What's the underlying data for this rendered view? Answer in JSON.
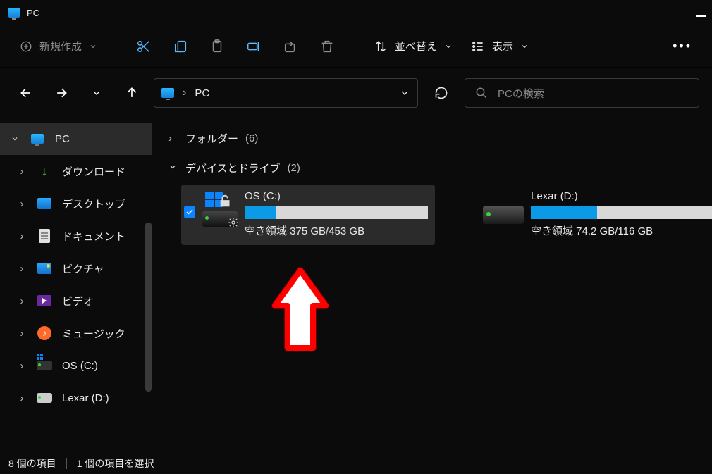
{
  "window": {
    "title": "PC"
  },
  "toolbar": {
    "new_label": "新規作成",
    "sort_label": "並べ替え",
    "view_label": "表示"
  },
  "breadcrumb": {
    "root": "PC"
  },
  "search": {
    "placeholder": "PCの検索"
  },
  "sidebar": {
    "items": [
      {
        "label": "PC",
        "icon": "monitor",
        "expanded": true,
        "selected": true
      },
      {
        "label": "ダウンロード",
        "icon": "download",
        "child": true
      },
      {
        "label": "デスクトップ",
        "icon": "desktop",
        "child": true
      },
      {
        "label": "ドキュメント",
        "icon": "document",
        "child": true
      },
      {
        "label": "ピクチャ",
        "icon": "pictures",
        "child": true
      },
      {
        "label": "ビデオ",
        "icon": "videos",
        "child": true
      },
      {
        "label": "ミュージック",
        "icon": "music",
        "child": true
      },
      {
        "label": "OS (C:)",
        "icon": "disk-os",
        "child": true
      },
      {
        "label": "Lexar (D:)",
        "icon": "disk",
        "child": true
      }
    ]
  },
  "groups": {
    "folders": {
      "label": "フォルダー",
      "count": "(6)"
    },
    "drives": {
      "label": "デバイスとドライブ",
      "count": "(2)"
    }
  },
  "drives": [
    {
      "name": "OS (C:)",
      "free_text": "空き領域 375 GB/453 GB",
      "fill_pct": 17,
      "selected": true,
      "system": true
    },
    {
      "name": "Lexar (D:)",
      "free_text": "空き領域 74.2 GB/116 GB",
      "fill_pct": 36,
      "selected": false,
      "system": false
    }
  ],
  "status": {
    "items_text": "8 個の項目",
    "selected_text": "1 個の項目を選択"
  }
}
